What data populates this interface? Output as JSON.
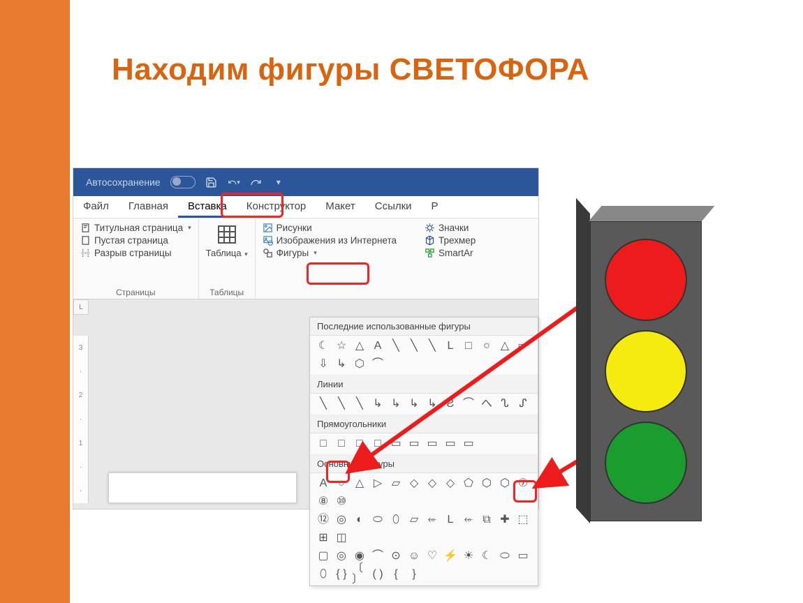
{
  "slide": {
    "title": "Находим фигуры СВЕТОФОРА"
  },
  "word": {
    "title_bar": {
      "autosave_label": "Автосохранение"
    },
    "tabs": {
      "file": "Файл",
      "home": "Главная",
      "insert": "Вставка",
      "design": "Конструктор",
      "layout": "Макет",
      "references": "Ссылки",
      "more": "Р"
    },
    "ribbon": {
      "pages": {
        "cover": "Титульная страница",
        "blank": "Пустая страница",
        "break": "Разрыв страницы",
        "group_label": "Страницы"
      },
      "table": {
        "button": "Таблица",
        "group_label": "Таблицы"
      },
      "illustrations": {
        "pictures": "Рисунки",
        "online_images": "Изображения из Интернета",
        "shapes": "Фигуры",
        "icons": "Значки",
        "three_d": "Трехмер",
        "smartart": "SmartAr"
      }
    },
    "shapes_menu": {
      "recently_used": "Последние использованные фигуры",
      "lines": "Линии",
      "rectangles": "Прямоугольники",
      "basic_shapes": "Основные фигуры"
    },
    "ruler": {
      "corner": "L",
      "marks": [
        "3",
        "·",
        "2",
        "·",
        "1",
        "·",
        "·"
      ]
    }
  },
  "shapes": {
    "recent": [
      "☾",
      "☆",
      "△",
      "A",
      "╲",
      "╲",
      "╲",
      "L",
      "□",
      "○",
      "△",
      "⇨",
      "⇩",
      "↳",
      "⬡",
      "⌒"
    ],
    "lines": [
      "╲",
      "╲",
      "╲",
      "↳",
      "↳",
      "↳",
      "↳",
      "Ƨ",
      "⌒",
      "へ",
      "ᔐ",
      "ᔑ"
    ],
    "rects": [
      "□",
      "□",
      "□",
      "□",
      "▭",
      "▭",
      "▭",
      "▭",
      "▭"
    ],
    "basic_row1": [
      "A",
      "○",
      "△",
      "▷",
      "▱",
      "◇",
      "◇",
      "◇",
      "⬠",
      "⬡",
      "⬡",
      "⑦",
      "⑧",
      "⑩"
    ],
    "basic_row2": [
      "⑫",
      "◎",
      "◐",
      "⬭",
      "⬯",
      "▱",
      "⬰",
      "L",
      "⬰",
      "⧉",
      "✚",
      "⬚",
      "⊞",
      "◫"
    ],
    "basic_row3": [
      "▢",
      "◎",
      "◉",
      "⌒",
      "⊙",
      "☺",
      "♡",
      "⚡",
      "☀",
      "☾",
      "⬭",
      "▭"
    ],
    "basic_row4": [
      "⬯",
      "{ }",
      "〔 〕",
      "(  )",
      "{",
      "}"
    ]
  },
  "traffic_light": {
    "colors": {
      "red": "#ED1C1C",
      "yellow": "#F5EB0F",
      "green": "#1B9C2F"
    }
  }
}
